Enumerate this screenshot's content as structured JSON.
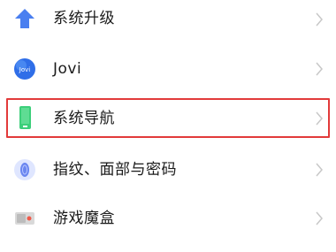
{
  "settings": {
    "items": [
      {
        "label": "系统升级",
        "icon": "arrow-up-icon"
      },
      {
        "label": "Jovi",
        "icon": "jovi-icon",
        "icon_text": "Jovi"
      },
      {
        "label": "系统导航",
        "icon": "phone-navigation-icon"
      },
      {
        "label": "指纹、面部与密码",
        "icon": "fingerprint-icon"
      },
      {
        "label": "游戏魔盒",
        "icon": "game-box-icon"
      }
    ]
  },
  "colors": {
    "highlight": "#e23a3a",
    "arrow_blue": "#4a7ff0",
    "jovi_blue": "#2f6ee8",
    "nav_green": "#3ccf7a",
    "fingerprint_blue": "#6a86f0",
    "chevron": "#c8c8c8"
  }
}
